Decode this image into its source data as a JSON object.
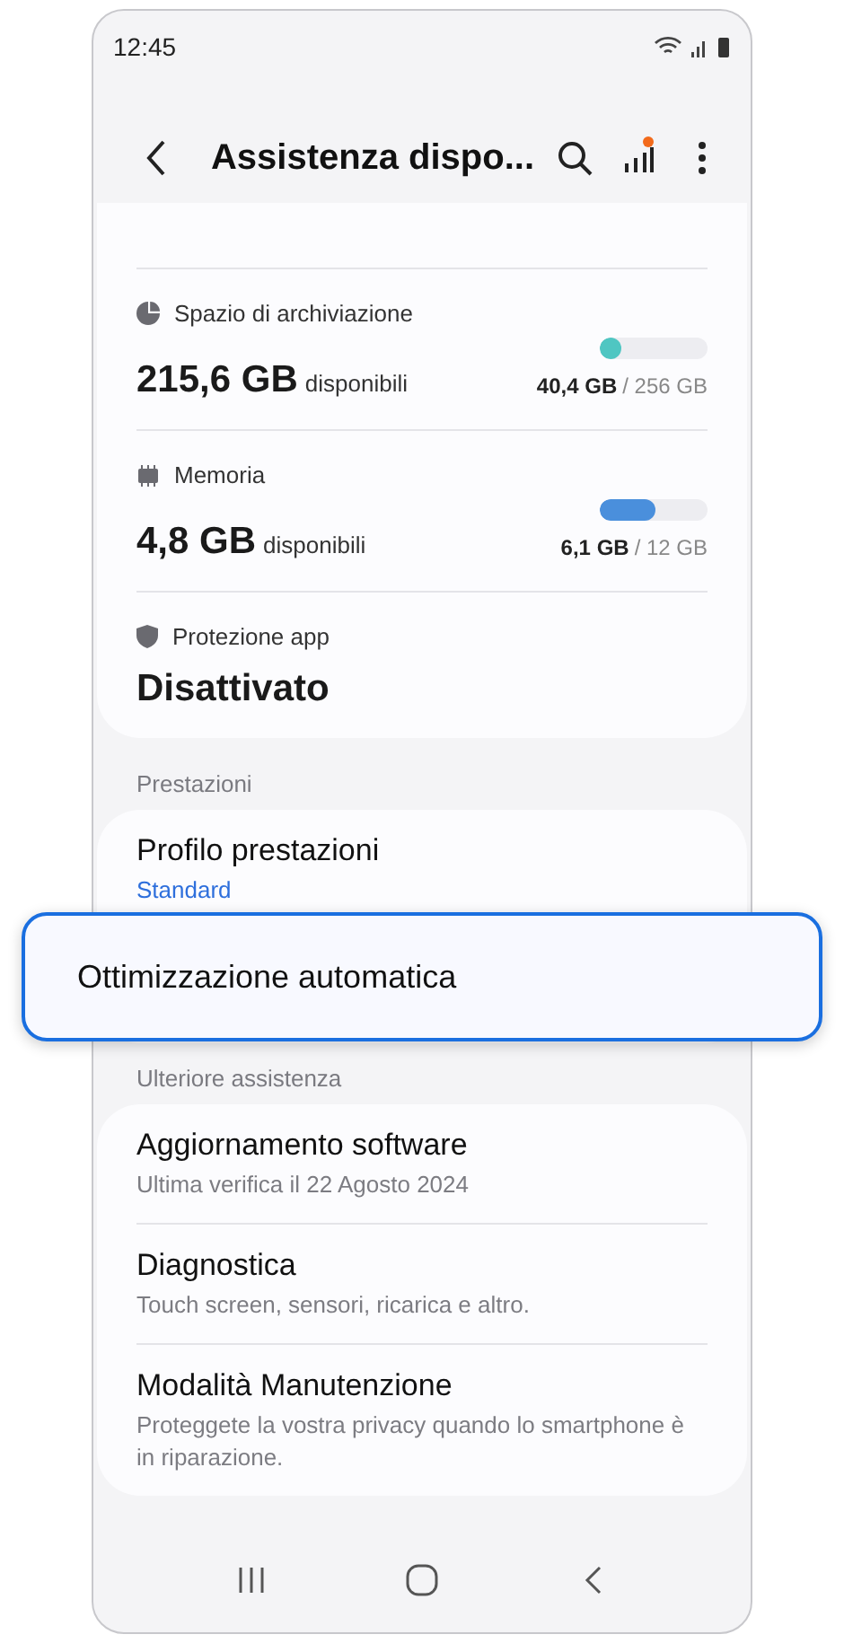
{
  "status_bar": {
    "time": "12:45"
  },
  "header": {
    "title": "Assistenza dispo...",
    "notification_dot": true
  },
  "device_card": [
    {
      "kind": "meter",
      "label": "Spazio di archiviazione",
      "value": "215,6 GB",
      "unit": "disponibili",
      "level": 0.16,
      "color": "#4fc6c2",
      "used": "40,4 GB",
      "total": "/ 256 GB"
    },
    {
      "kind": "meter",
      "label": "Memoria",
      "value": "4,8 GB",
      "unit": "disponibili",
      "level": 0.51,
      "color": "#4a8fdc",
      "used": "6,1 GB",
      "total": "/ 12 GB"
    },
    {
      "kind": "status",
      "label": "Protezione app",
      "value": "Disattivato"
    }
  ],
  "sections": [
    {
      "title": "Prestazioni",
      "items": [
        {
          "title": "Profilo prestazioni",
          "subtitle": "Standard",
          "kind": "value"
        }
      ]
    },
    {
      "title": "Ulteriore assistenza",
      "items": [
        {
          "title": "Aggiornamento software",
          "subtitle": "Ultima verifica il 22 Agosto 2024",
          "kind": "description"
        },
        {
          "title": "Diagnostica",
          "subtitle": "Touch screen, sensori, ricarica e altro.",
          "kind": "description"
        },
        {
          "title": "Modalità Manutenzione",
          "subtitle": "Proteggete la vostra privacy quando lo smartphone è in riparazione.",
          "kind": "description"
        }
      ]
    }
  ],
  "callout": {
    "title": "Ottimizzazione automatica"
  }
}
